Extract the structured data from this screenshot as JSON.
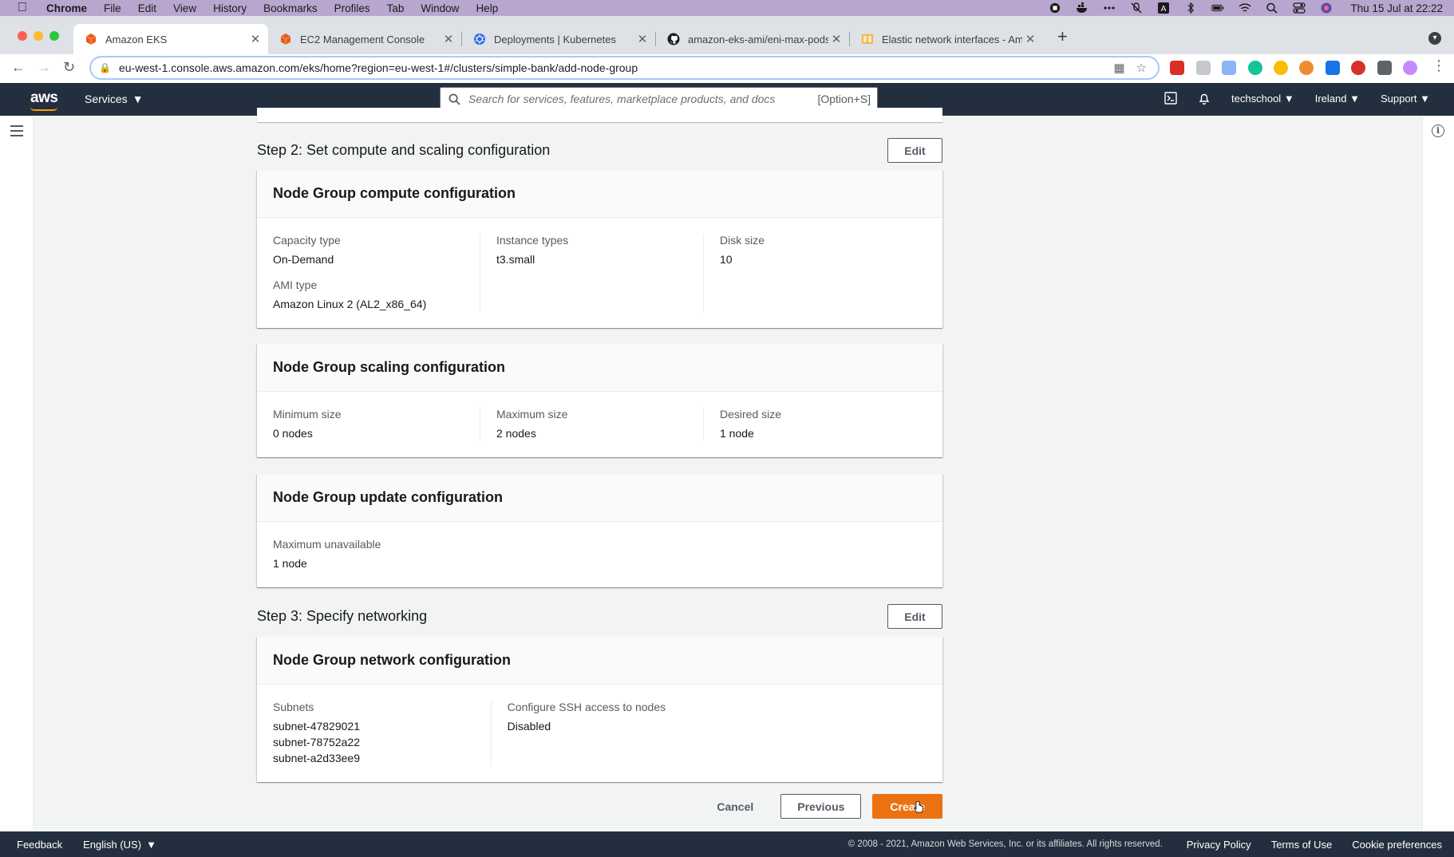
{
  "menubar": {
    "app": "Chrome",
    "items": [
      "File",
      "Edit",
      "View",
      "History",
      "Bookmarks",
      "Profiles",
      "Tab",
      "Window",
      "Help"
    ],
    "clock": "Thu 15 Jul at  22:22"
  },
  "tabs": [
    {
      "title": "Amazon EKS",
      "icon": "aws-cube-icon",
      "active": true
    },
    {
      "title": "EC2 Management Console",
      "icon": "aws-cube-icon",
      "active": false
    },
    {
      "title": "Deployments | Kubernetes",
      "icon": "kubernetes-icon",
      "active": false
    },
    {
      "title": "amazon-eks-ami/eni-max-pods",
      "icon": "github-icon",
      "active": false
    },
    {
      "title": "Elastic network interfaces - Am",
      "icon": "aws-docs-icon",
      "active": false
    }
  ],
  "address_bar": {
    "url": "eu-west-1.console.aws.amazon.com/eks/home?region=eu-west-1#/clusters/simple-bank/add-node-group"
  },
  "aws_header": {
    "logo": "aws",
    "services": "Services",
    "search_placeholder": "Search for services, features, marketplace products, and docs",
    "search_shortcut": "[Option+S]",
    "account": "techschool",
    "region": "Ireland",
    "support": "Support"
  },
  "step2": {
    "title": "Step 2: Set compute and scaling configuration",
    "edit_label": "Edit",
    "compute": {
      "title": "Node Group compute configuration",
      "capacity_type_label": "Capacity type",
      "capacity_type": "On-Demand",
      "ami_type_label": "AMI type",
      "ami_type": "Amazon Linux 2 (AL2_x86_64)",
      "instance_types_label": "Instance types",
      "instance_types": "t3.small",
      "disk_size_label": "Disk size",
      "disk_size": "10"
    },
    "scaling": {
      "title": "Node Group scaling configuration",
      "min_label": "Minimum size",
      "min": "0 nodes",
      "max_label": "Maximum size",
      "max": "2 nodes",
      "desired_label": "Desired size",
      "desired": "1 node"
    },
    "update": {
      "title": "Node Group update configuration",
      "max_unavailable_label": "Maximum unavailable",
      "max_unavailable": "1 node"
    }
  },
  "step3": {
    "title": "Step 3: Specify networking",
    "edit_label": "Edit",
    "network": {
      "title": "Node Group network configuration",
      "subnets_label": "Subnets",
      "subnets": [
        "subnet-47829021",
        "subnet-78752a22",
        "subnet-a2d33ee9"
      ],
      "ssh_label": "Configure SSH access to nodes",
      "ssh": "Disabled"
    }
  },
  "actions": {
    "cancel": "Cancel",
    "previous": "Previous",
    "create": "Create"
  },
  "footer": {
    "feedback": "Feedback",
    "language": "English (US)",
    "copyright": "© 2008 - 2021, Amazon Web Services, Inc. or its affiliates. All rights reserved.",
    "privacy": "Privacy Policy",
    "terms": "Terms of Use",
    "cookies": "Cookie preferences"
  },
  "colors": {
    "aws_nav": "#232f3e",
    "primary_button": "#ec7211",
    "menubar": "#b8a6cf"
  }
}
